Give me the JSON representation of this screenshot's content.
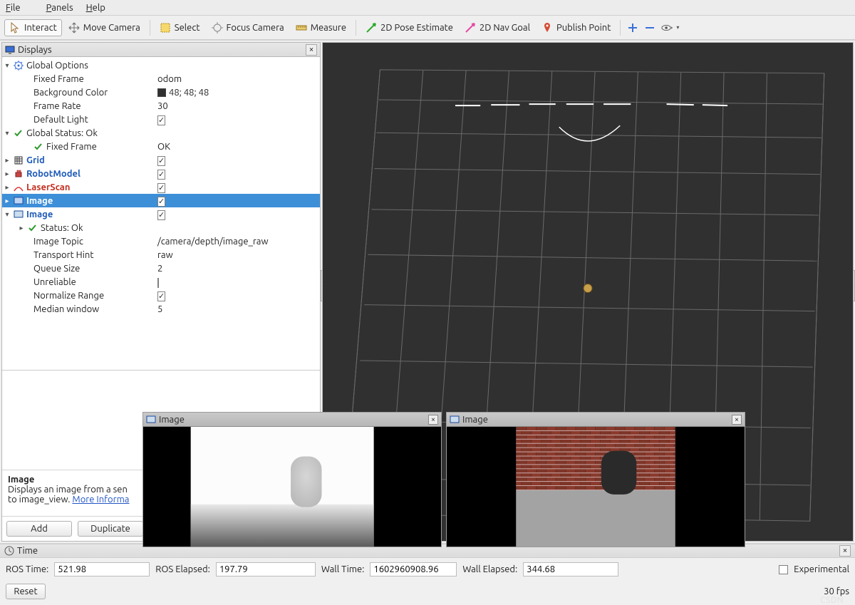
{
  "menubar": {
    "file": "File",
    "panels": "Panels",
    "help": "Help"
  },
  "toolbar": {
    "interact": "Interact",
    "move_camera": "Move Camera",
    "select": "Select",
    "focus_camera": "Focus Camera",
    "measure": "Measure",
    "pose_estimate": "2D Pose Estimate",
    "nav_goal": "2D Nav Goal",
    "publish_point": "Publish Point"
  },
  "displays_panel": {
    "title": "Displays",
    "global_options": {
      "label": "Global Options",
      "fixed_frame": {
        "label": "Fixed Frame",
        "value": "odom"
      },
      "bg_color": {
        "label": "Background Color",
        "value": "48; 48; 48"
      },
      "frame_rate": {
        "label": "Frame Rate",
        "value": "30"
      },
      "default_light": {
        "label": "Default Light",
        "checked": true
      }
    },
    "global_status": {
      "label": "Global Status: Ok",
      "fixed_frame": {
        "label": "Fixed Frame",
        "value": "OK"
      }
    },
    "grid": {
      "label": "Grid",
      "checked": true
    },
    "robot_model": {
      "label": "RobotModel",
      "checked": true
    },
    "laser_scan": {
      "label": "LaserScan",
      "checked": true
    },
    "image_sel": {
      "label": "Image",
      "checked": true
    },
    "image2": {
      "label": "Image",
      "checked": true,
      "status": "Status: Ok",
      "topic": {
        "label": "Image Topic",
        "value": "/camera/depth/image_raw"
      },
      "transport": {
        "label": "Transport Hint",
        "value": "raw"
      },
      "queue": {
        "label": "Queue Size",
        "value": "2"
      },
      "unreliable": {
        "label": "Unreliable",
        "checked": false
      },
      "normalize": {
        "label": "Normalize Range",
        "checked": true
      },
      "median": {
        "label": "Median window",
        "value": "5"
      }
    }
  },
  "description": {
    "title": "Image",
    "text1": "Displays an image from a sen",
    "text2": "to image_view. ",
    "link": "More Informa"
  },
  "buttons": {
    "add": "Add",
    "duplicate": "Duplicate"
  },
  "docks": {
    "image1_title": "Image",
    "image2_title": "Image"
  },
  "time_panel": {
    "title": "Time"
  },
  "status": {
    "ros_time": {
      "label": "ROS Time:",
      "value": "521.98"
    },
    "ros_elapsed": {
      "label": "ROS Elapsed:",
      "value": "197.79"
    },
    "wall_time": {
      "label": "Wall Time:",
      "value": "1602960908.96"
    },
    "wall_elapsed": {
      "label": "Wall Elapsed:",
      "value": "344.68"
    },
    "experimental": "Experimental"
  },
  "footer": {
    "reset": "Reset",
    "fps": "30 fps"
  }
}
